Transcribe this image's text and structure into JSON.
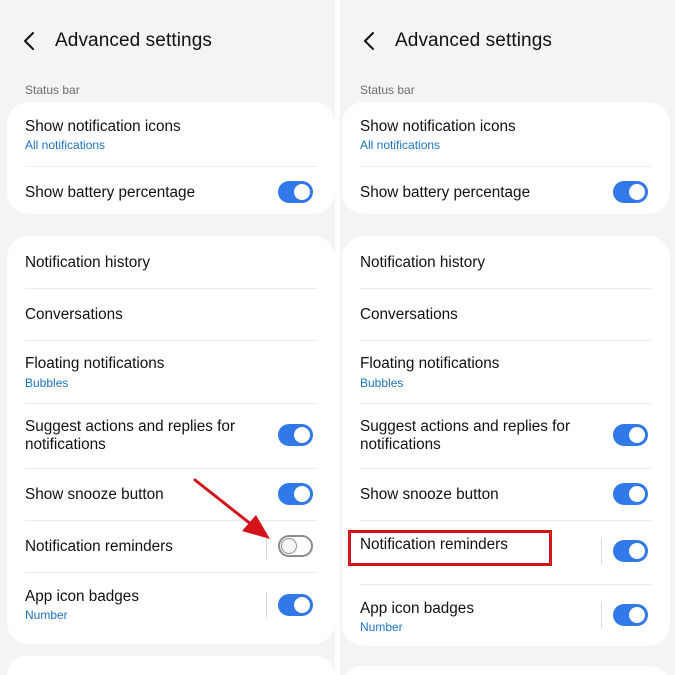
{
  "header": {
    "title": "Advanced settings"
  },
  "status_bar_section": {
    "label": "Status bar",
    "show_notification_icons": {
      "label": "Show notification icons",
      "sub": "All notifications"
    },
    "show_battery_percentage": {
      "label": "Show battery percentage",
      "enabled": true
    }
  },
  "settings": {
    "notification_history": {
      "label": "Notification history"
    },
    "conversations": {
      "label": "Conversations"
    },
    "floating_notifications": {
      "label": "Floating notifications",
      "sub": "Bubbles"
    },
    "suggest_actions": {
      "label": "Suggest actions and replies for notifications",
      "enabled": true
    },
    "show_snooze": {
      "label": "Show snooze button",
      "enabled": true
    },
    "notification_reminders": {
      "label": "Notification reminders"
    },
    "app_icon_badges": {
      "label": "App icon badges",
      "sub": "Number",
      "enabled": true
    }
  },
  "left_panel": {
    "notification_reminders_enabled": false
  },
  "right_panel": {
    "notification_reminders_enabled": true
  },
  "colors": {
    "accent": "#3179e8",
    "link": "#1a73c7",
    "toggle_off": "#8c8c8c",
    "annotation_red": "#d4141b",
    "background": "#f4f4f4"
  },
  "icons": {
    "back": "chevron-left-icon",
    "annotation_arrow": "red-arrow-icon"
  }
}
